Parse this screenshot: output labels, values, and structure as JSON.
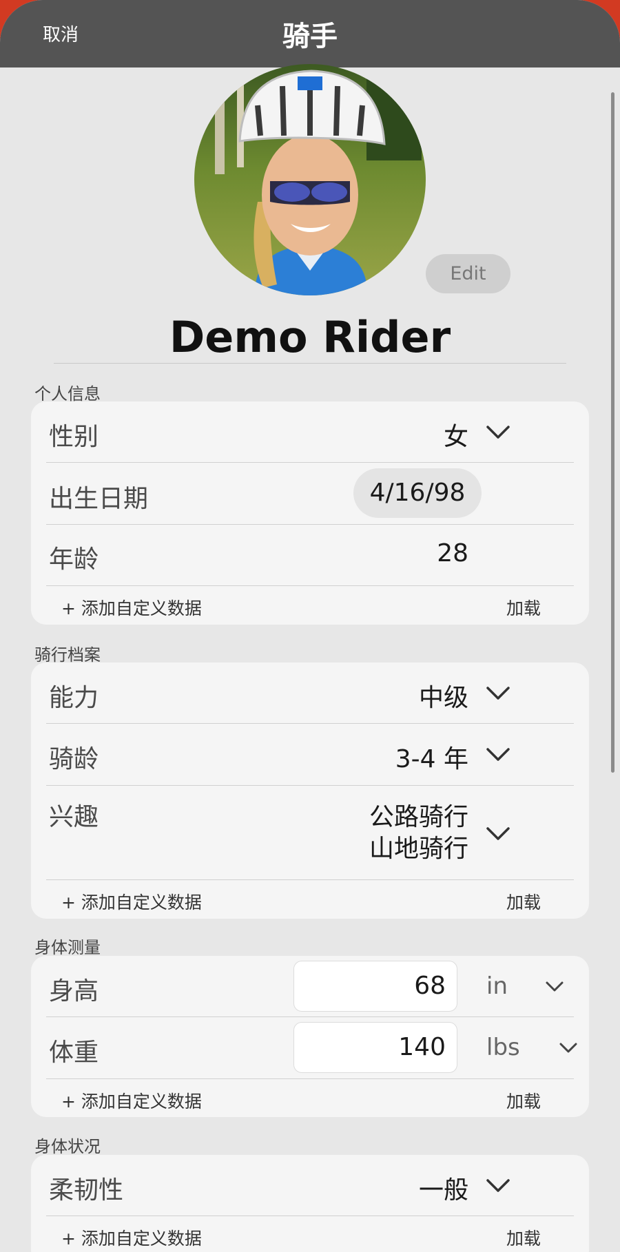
{
  "nav": {
    "cancel_label": "取消",
    "title": "骑手"
  },
  "profile": {
    "edit_label": "Edit",
    "name": "Demo Rider"
  },
  "sections": {
    "personal": {
      "header": "个人信息",
      "gender_label": "性别",
      "gender_value": "女",
      "dob_label": "出生日期",
      "dob_value": "4/16/98",
      "age_label": "年龄",
      "age_value": "28",
      "add_label": "+ 添加自定义数据",
      "load_label": "加载"
    },
    "riding": {
      "header": "骑行档案",
      "ability_label": "能力",
      "ability_value": "中级",
      "years_label": "骑龄",
      "years_value": "3-4 年",
      "interest_label": "兴趣",
      "interest_value_1": "公路骑行",
      "interest_value_2": "山地骑行",
      "add_label": "+ 添加自定义数据",
      "load_label": "加载"
    },
    "body": {
      "header": "身体测量",
      "height_label": "身高",
      "height_value": "68",
      "height_unit": "in",
      "weight_label": "体重",
      "weight_value": "140",
      "weight_unit": "lbs",
      "add_label": "+ 添加自定义数据",
      "load_label": "加载"
    },
    "condition": {
      "header": "身体状况",
      "flex_label": "柔韧性",
      "flex_value": "一般",
      "add_label": "+ 添加自定义数据",
      "load_label": "加载"
    }
  },
  "icons": {
    "dropdown": "chevron-down-icon",
    "avatar": "rider-photo"
  },
  "colors": {
    "navbar": "#545454",
    "background": "#e7e7e7",
    "card": "#f5f5f5",
    "frame": "#d23a22"
  }
}
